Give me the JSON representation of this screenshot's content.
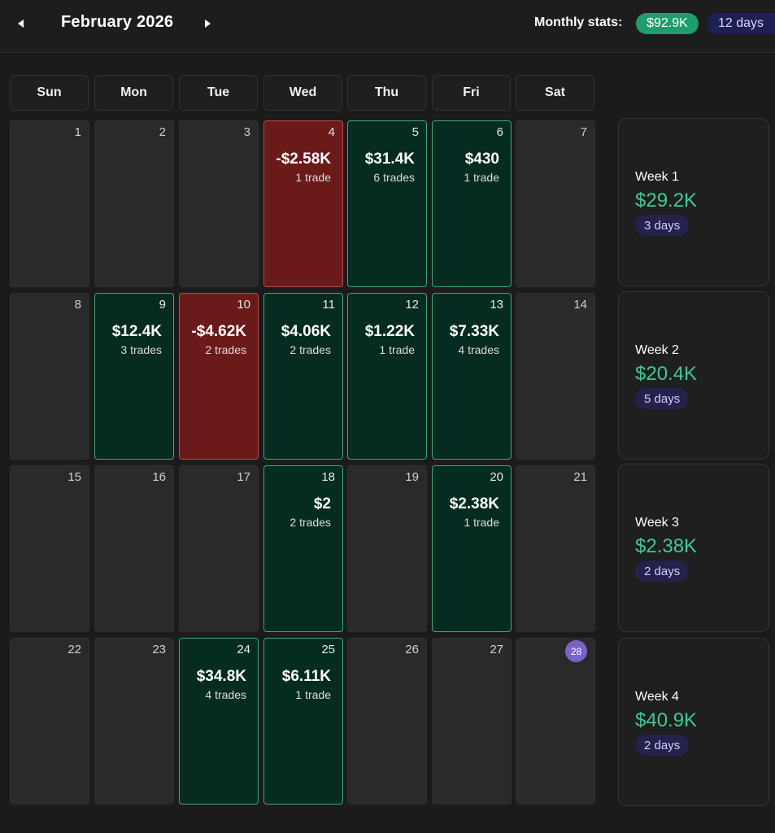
{
  "header": {
    "month_title": "February 2026",
    "prev_icon": "chevron-left-icon",
    "next_icon": "chevron-right-icon",
    "stats_label": "Monthly stats:",
    "monthly_pnl": "$92.9K",
    "monthly_days": "12 days"
  },
  "colors": {
    "profit_bg": "#062b21",
    "profit_border": "#3aa879",
    "loss_bg": "#6b1a1a",
    "loss_border": "#b94848",
    "profit_text": "#3ec995",
    "today": "#7b62c9"
  },
  "weekdays": [
    "Sun",
    "Mon",
    "Tue",
    "Wed",
    "Thu",
    "Fri",
    "Sat"
  ],
  "days": [
    {
      "day": "1",
      "status": "none"
    },
    {
      "day": "2",
      "status": "none"
    },
    {
      "day": "3",
      "status": "none"
    },
    {
      "day": "4",
      "status": "loss",
      "pnl": "-$2.58K",
      "trades": "1 trade"
    },
    {
      "day": "5",
      "status": "profit",
      "pnl": "$31.4K",
      "trades": "6 trades"
    },
    {
      "day": "6",
      "status": "profit",
      "pnl": "$430",
      "trades": "1 trade"
    },
    {
      "day": "7",
      "status": "none"
    },
    {
      "day": "8",
      "status": "none"
    },
    {
      "day": "9",
      "status": "profit",
      "pnl": "$12.4K",
      "trades": "3 trades"
    },
    {
      "day": "10",
      "status": "loss",
      "pnl": "-$4.62K",
      "trades": "2 trades"
    },
    {
      "day": "11",
      "status": "profit",
      "pnl": "$4.06K",
      "trades": "2 trades"
    },
    {
      "day": "12",
      "status": "profit",
      "pnl": "$1.22K",
      "trades": "1 trade"
    },
    {
      "day": "13",
      "status": "profit",
      "pnl": "$7.33K",
      "trades": "4 trades"
    },
    {
      "day": "14",
      "status": "none"
    },
    {
      "day": "15",
      "status": "none"
    },
    {
      "day": "16",
      "status": "none"
    },
    {
      "day": "17",
      "status": "none"
    },
    {
      "day": "18",
      "status": "profit",
      "pnl": "$2",
      "trades": "2 trades"
    },
    {
      "day": "19",
      "status": "none"
    },
    {
      "day": "20",
      "status": "profit",
      "pnl": "$2.38K",
      "trades": "1 trade"
    },
    {
      "day": "21",
      "status": "none"
    },
    {
      "day": "22",
      "status": "none"
    },
    {
      "day": "23",
      "status": "none"
    },
    {
      "day": "24",
      "status": "profit",
      "pnl": "$34.8K",
      "trades": "4 trades"
    },
    {
      "day": "25",
      "status": "profit",
      "pnl": "$6.11K",
      "trades": "1 trade"
    },
    {
      "day": "26",
      "status": "none"
    },
    {
      "day": "27",
      "status": "none"
    },
    {
      "day": "28",
      "status": "none",
      "today": true
    }
  ],
  "weeks": [
    {
      "label": "Week 1",
      "pnl": "$29.2K",
      "days": "3 days"
    },
    {
      "label": "Week 2",
      "pnl": "$20.4K",
      "days": "5 days"
    },
    {
      "label": "Week 3",
      "pnl": "$2.38K",
      "days": "2 days"
    },
    {
      "label": "Week 4",
      "pnl": "$40.9K",
      "days": "2 days"
    }
  ]
}
